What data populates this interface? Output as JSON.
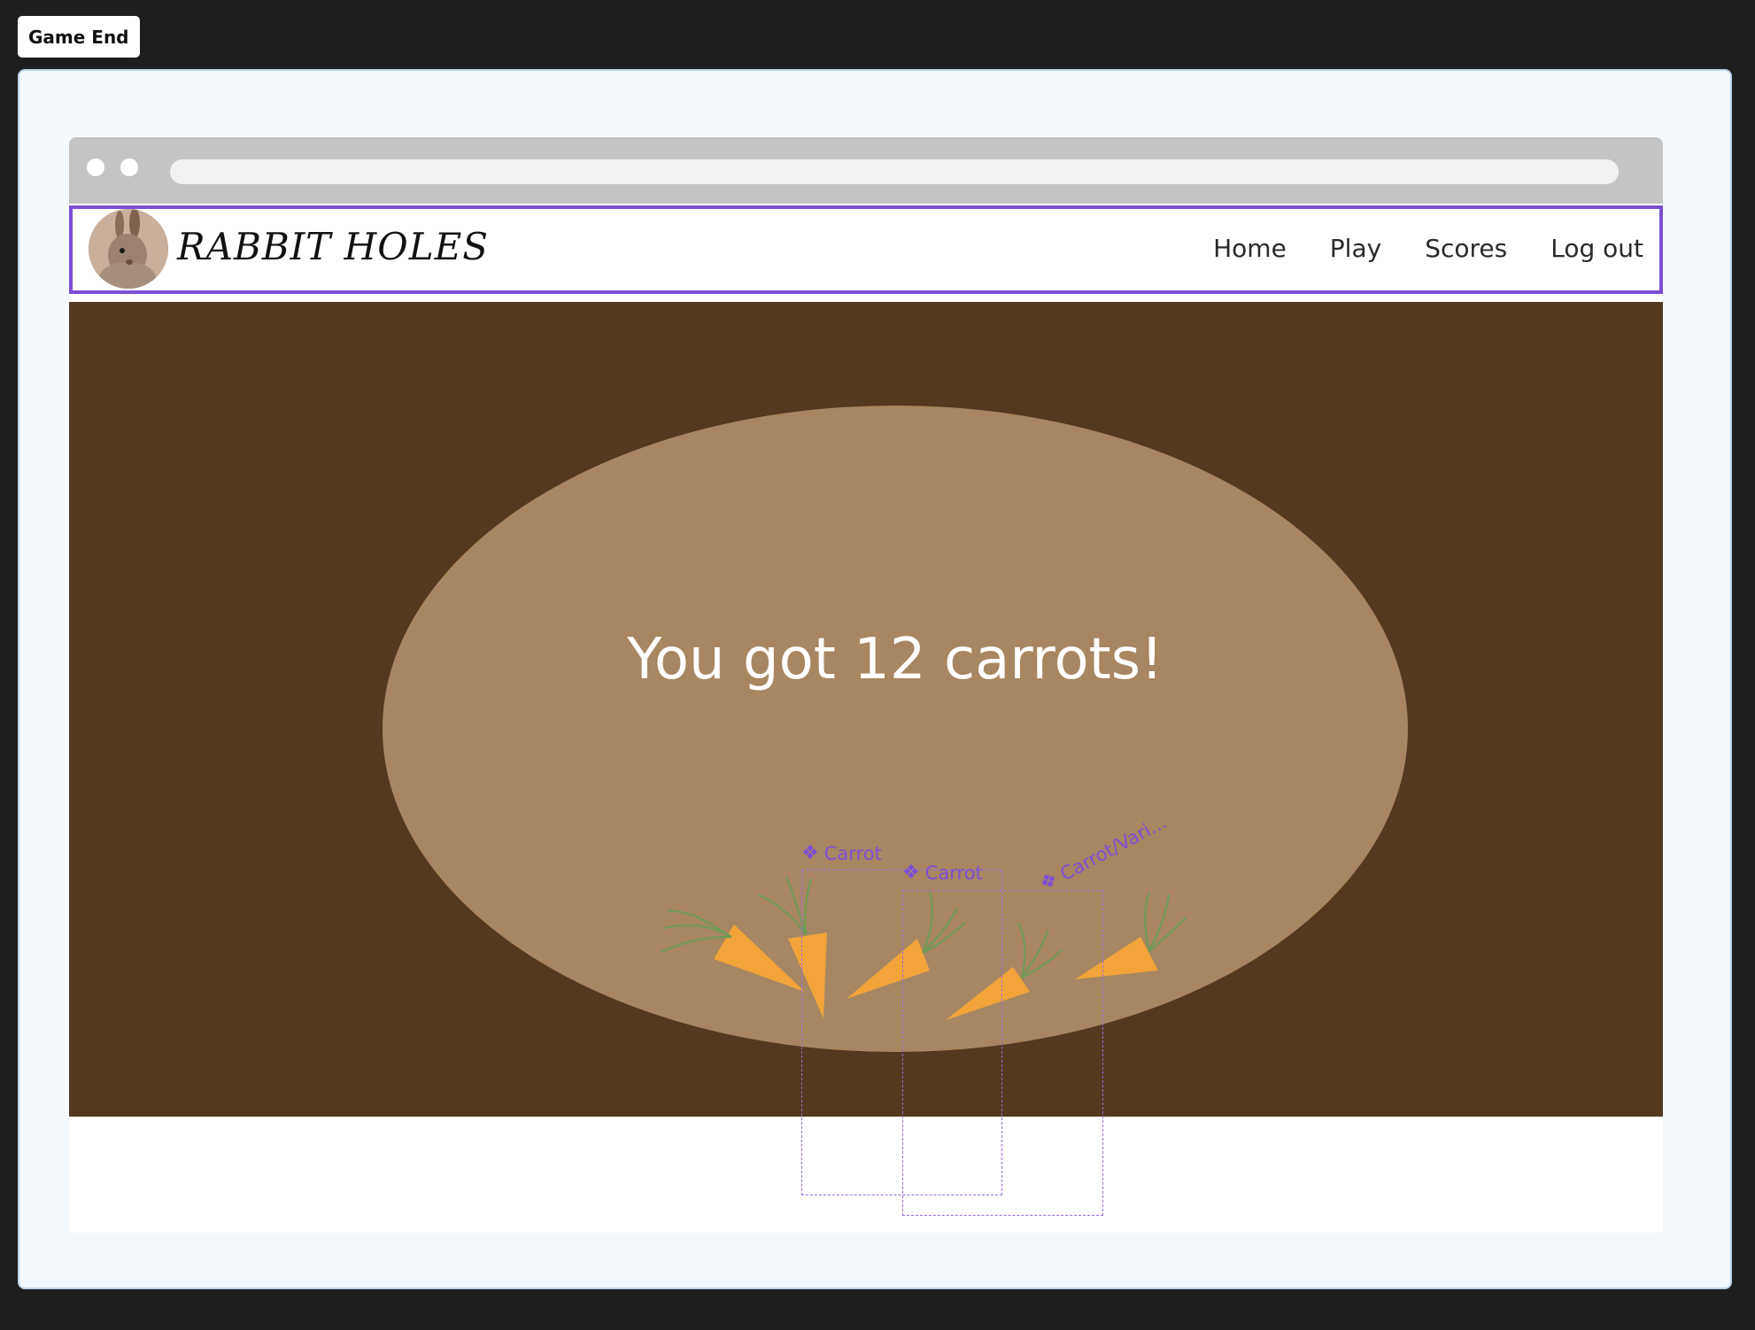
{
  "frame_label": "Game End",
  "nav": {
    "brand": "RABBIT HOLES",
    "links": [
      "Home",
      "Play",
      "Scores",
      "Log out"
    ]
  },
  "game": {
    "result": "You got 12 carrots!"
  },
  "design_overlays": {
    "component_1": "Carrot",
    "component_2": "Carrot",
    "component_3": "Carrot/Vari..."
  },
  "icons": {
    "component_glyph": "❖",
    "variant_glyph": "❖"
  },
  "colors": {
    "dirt_dark": "#523920",
    "hole": "#a78661",
    "carrot": "#f2a43a",
    "leaf": "#6f9a55",
    "selection": "#7b4fd6"
  }
}
